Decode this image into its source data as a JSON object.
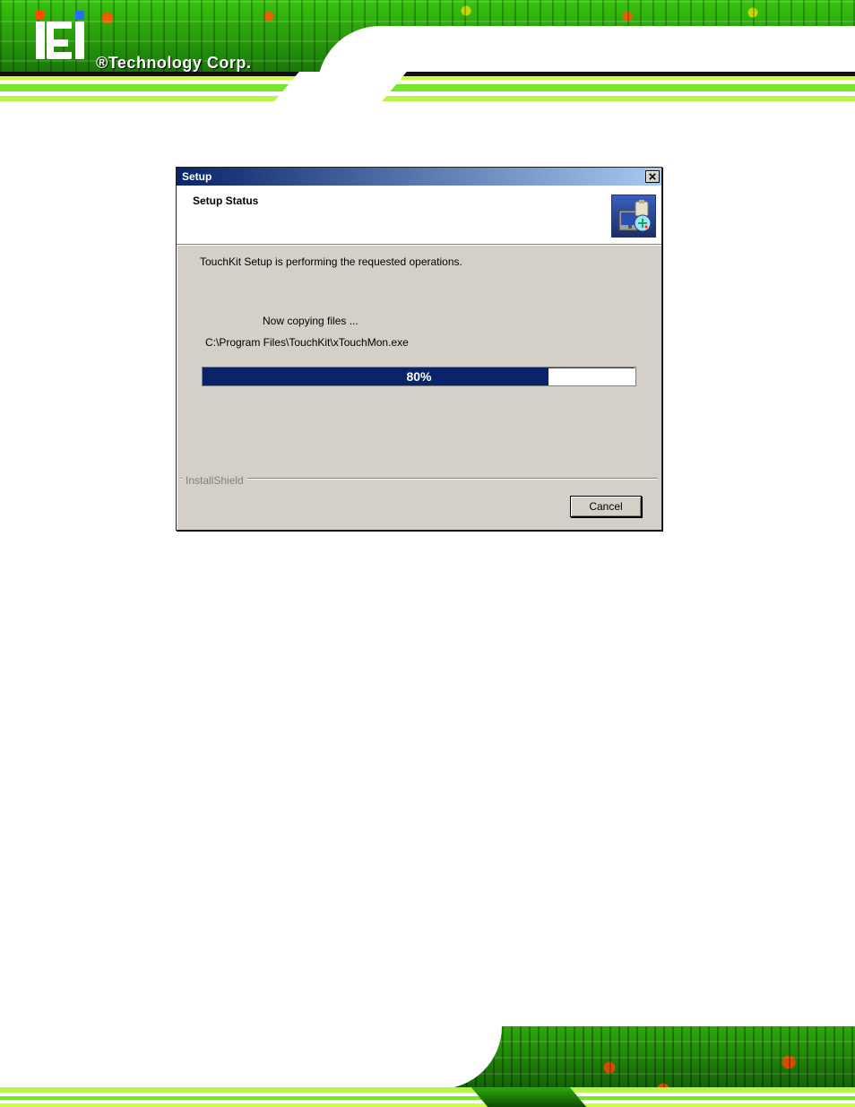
{
  "brand_text": "®Technology Corp.",
  "dialog": {
    "title": "Setup",
    "banner_title": "Setup Status",
    "msg_main": "TouchKit Setup is performing the requested operations.",
    "msg_action": "Now copying files ...",
    "msg_path": "C:\\Program Files\\TouchKit\\xTouchMon.exe",
    "progress_text": "80%",
    "progress_percent": 80,
    "fieldset_label": "InstallShield",
    "cancel_label": "Cancel"
  }
}
